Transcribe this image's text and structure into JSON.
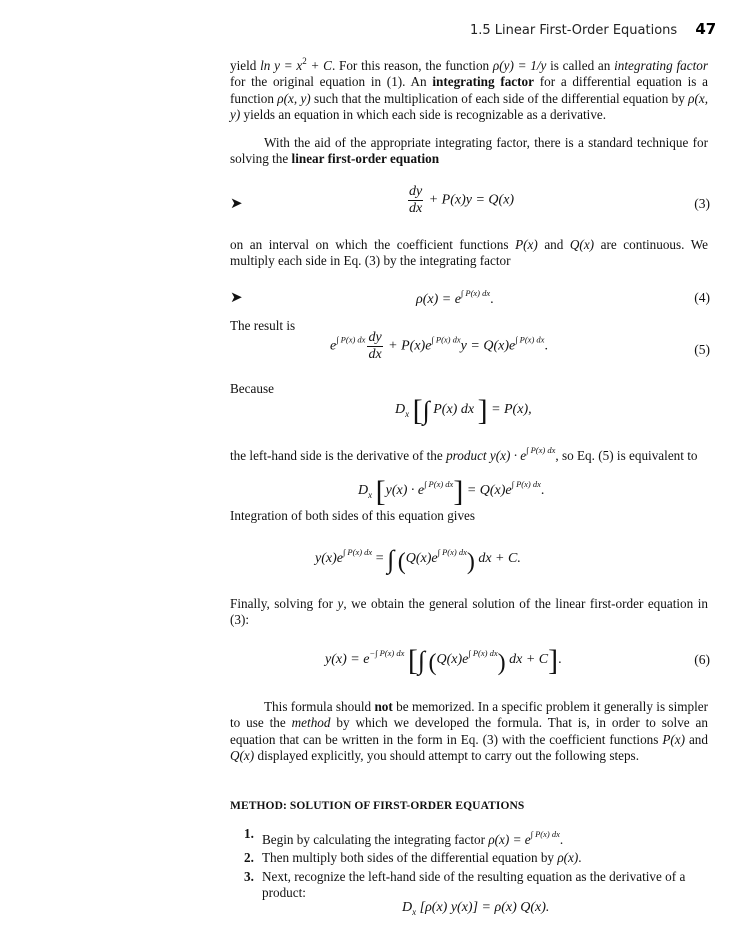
{
  "header": {
    "section_title": "1.5 Linear First-Order Equations",
    "page_number": "47"
  },
  "paragraphs": {
    "p1": {
      "a": "yield ",
      "b": "ln y = x",
      "c": " + C",
      "d": ". For this reason, the function ",
      "e": "ρ(y) = 1/y",
      "f": " is called an ",
      "g": "integrating factor",
      "h": " for the original equation in (1). An ",
      "i": "integrating factor",
      "j": " for a differential equation is a function ",
      "k": "ρ(x, y)",
      "l": " such that the multiplication of each side of the differential equation by ",
      "m": "ρ(x, y)",
      "n": " yields an equation in which each side is recognizable as a derivative."
    },
    "p2": {
      "a": "With the aid of the appropriate integrating factor, there is a standard technique for solving the ",
      "b": "linear first-order equation"
    },
    "p3": {
      "a": "on an interval on which the coefficient functions ",
      "b": "P(x)",
      "c": " and ",
      "d": "Q(x)",
      "e": " are continuous. We multiply each side in Eq. (3) by the integrating factor"
    },
    "p4": "The result is",
    "p5": "Because",
    "p6": {
      "a": "the left-hand side is the derivative of the ",
      "b": "product",
      "c": " y(x) · e",
      "d": "∫ P(x) dx",
      "e": ", so Eq. (5) is equivalent to"
    },
    "p7": "Integration of both sides of this equation gives",
    "p8": {
      "a": "Finally, solving for ",
      "b": "y",
      "c": ", we obtain the general solution of the linear first-order equation in (3):"
    },
    "p9": {
      "a": "This formula should ",
      "b": "not",
      "c": " be memorized. In a specific problem it generally is simpler to use the ",
      "d": "method",
      "e": " by which we developed the formula. That is, in order to solve an equation that can be written in the form in Eq. (3) with the coefficient functions ",
      "f": "P(x)",
      "g": " and ",
      "h": "Q(x)",
      "i": " displayed explicitly, you should attempt to carry out the following steps."
    }
  },
  "equations": {
    "eq3": {
      "num": "dy",
      "den": "dx",
      "rest": "+ P(x)y = Q(x)",
      "label": "(3)"
    },
    "eq4": {
      "lhs": "ρ(x) = e",
      "exp": "∫ P(x) dx",
      "end": ".",
      "label": "(4)"
    },
    "eq5": {
      "e1": "e",
      "exp1": "∫ P(x) dx",
      "num": "dy",
      "den": "dx",
      "mid": "+ P(x)e",
      "exp2": "∫ P(x) dx",
      "y": "y = Q(x)e",
      "exp3": "∫ P(x) dx",
      "end": ".",
      "label": "(5)"
    },
    "eq_because": {
      "d": "D",
      "sub": "x",
      "inner": "P(x) dx",
      "rhs": "= P(x),"
    },
    "eq_equiv": {
      "d": "D",
      "sub": "x",
      "inner": "y(x) · e",
      "exp1": "∫ P(x) dx",
      "rhs": "= Q(x)e",
      "exp2": "∫ P(x) dx",
      "end": "."
    },
    "eq_integrated": {
      "lhs": "y(x)e",
      "exp1": "∫ P(x) dx",
      "eq": "=",
      "inner": "Q(x)e",
      "exp2": "∫ P(x) dx",
      "rhs": "dx + C."
    },
    "eq6": {
      "lhs": "y(x) = e",
      "exp1": "−∫ P(x) dx",
      "inner": "Q(x)e",
      "exp2": "∫ P(x) dx",
      "rhs": "dx + C",
      "end": ".",
      "label": "(6)"
    }
  },
  "method": {
    "heading": "METHOD: SOLUTION OF FIRST-ORDER EQUATIONS",
    "steps": [
      {
        "n": "1.",
        "a": "Begin by calculating the integrating factor ",
        "b": "ρ(x) = e",
        "exp": "∫ P(x) dx",
        "c": "."
      },
      {
        "n": "2.",
        "a": "Then multiply both sides of the differential equation by ",
        "b": "ρ(x)",
        "c": "."
      },
      {
        "n": "3.",
        "a": "Next, recognize the left-hand side of the resulting equation as the derivative of a product:"
      }
    ],
    "final_eq": {
      "d": "D",
      "sub": "x",
      "body": "[ρ(x) y(x)] = ρ(x) Q(x)."
    }
  },
  "icons": {
    "arrow": "➤"
  }
}
